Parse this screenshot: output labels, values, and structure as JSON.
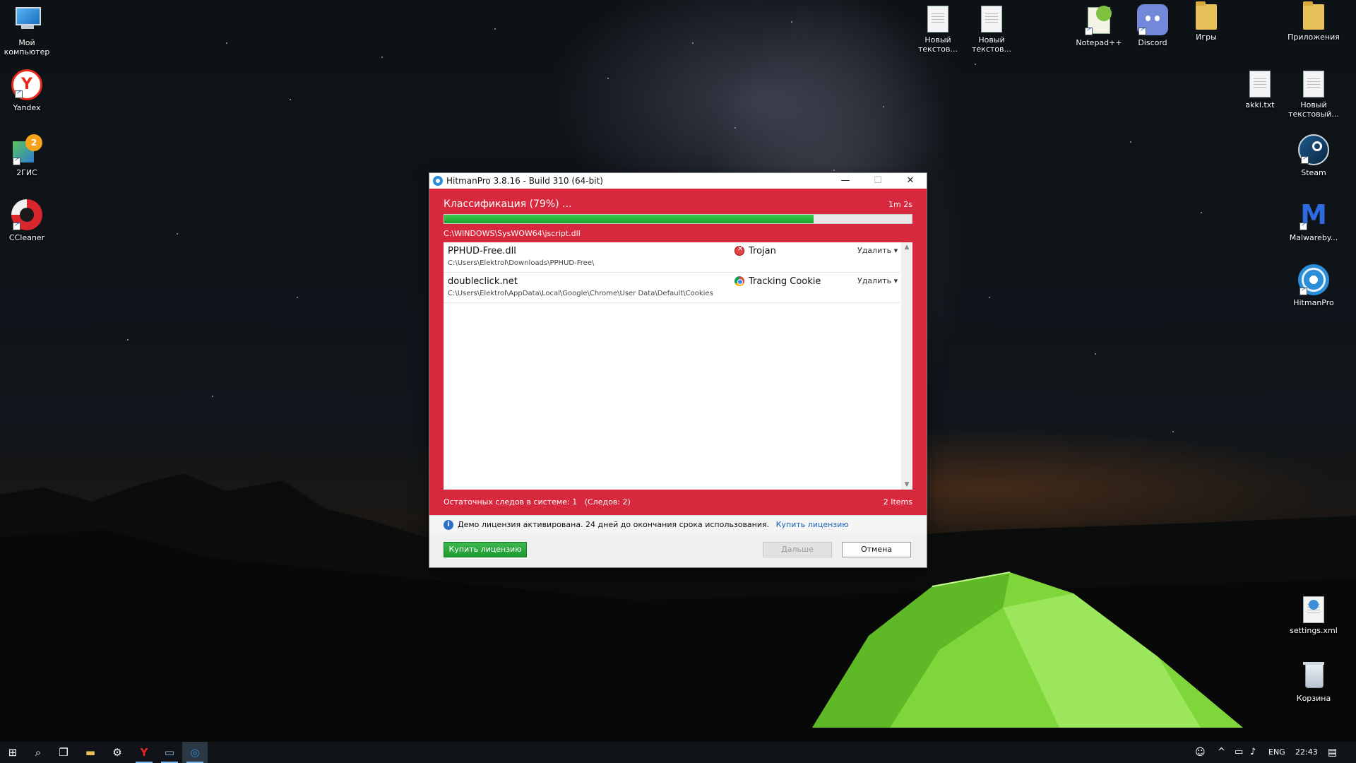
{
  "desktop": {
    "left_icons": [
      {
        "label": "Мой компьютер",
        "icon": "computer-icon"
      },
      {
        "label": "Yandex",
        "icon": "yandex-icon"
      },
      {
        "label": "2ГИС",
        "icon": "2gis-icon"
      },
      {
        "label": "CCleaner",
        "icon": "ccleaner-icon"
      }
    ],
    "top_icons": [
      {
        "label": "Новый текстов...",
        "icon": "text-document-icon"
      },
      {
        "label": "Новый текстов...",
        "icon": "text-document-icon"
      },
      {
        "label": "Notepad++",
        "icon": "notepadpp-icon"
      },
      {
        "label": "Discord",
        "icon": "discord-icon"
      },
      {
        "label": "Игры",
        "icon": "folder-icon"
      },
      {
        "label": "Приложения",
        "icon": "folder-icon"
      }
    ],
    "right_icons": [
      {
        "label": "akki.txt",
        "icon": "text-document-icon"
      },
      {
        "label": "Новый текстовый...",
        "icon": "text-document-icon"
      },
      {
        "label": "Steam",
        "icon": "steam-icon"
      },
      {
        "label": "Malwareby...",
        "icon": "malwarebytes-icon"
      },
      {
        "label": "HitmanPro",
        "icon": "hitmanpro-icon"
      },
      {
        "label": "settings.xml",
        "icon": "xml-document-icon"
      },
      {
        "label": "Корзина",
        "icon": "recycle-bin-icon"
      }
    ]
  },
  "window": {
    "title": "HitmanPro 3.8.16 - Build 310 (64-bit)",
    "controls": {
      "minimize": "—",
      "maximize": "☐",
      "close": "✕"
    },
    "status": "Классификация (79%) ...",
    "elapsed": "1m 2s",
    "progress_percent": 79,
    "current_file": "C:\\WINDOWS\\SysWOW64\\jscript.dll",
    "results": [
      {
        "name": "PPHUD-Free.dll",
        "path": "C:\\Users\\Elektrol\\Downloads\\PPHUD-Free\\",
        "type": "Trojan",
        "type_icon": "trojan-icon",
        "action": "Удалить ▾"
      },
      {
        "name": "doubleclick.net",
        "path": "C:\\Users\\Elektrol\\AppData\\Local\\Google\\Chrome\\User Data\\Default\\Cookies",
        "type": "Tracking Cookie",
        "type_icon": "chrome-icon",
        "action": "Удалить ▾"
      }
    ],
    "scroll_up": "▲",
    "scroll_down": "▼",
    "footer_left": "Остаточных следов в системе: 1   (Следов: 2)",
    "footer_right": "2 Items",
    "info_icon": "i",
    "info_text": "Демо лицензия активирована. 24 дней до окончания срока использования.",
    "info_link": "Купить лицензию",
    "buttons": {
      "buy": "Купить лицензию",
      "next": "Дальше",
      "cancel": "Отмена"
    },
    "colors": {
      "accent": "#d8283d",
      "progress": "#1aa530",
      "link": "#1a63b8"
    }
  },
  "taskbar": {
    "start": "⊞",
    "search": "⌕",
    "taskview": "❐",
    "explorer": "▬",
    "settings": "⚙",
    "yandex": "Y",
    "app": "▭",
    "hitmanpro": "◎",
    "tray_people": "☺",
    "tray_chevron": "^",
    "tray_network": "▭",
    "tray_volume": "♪",
    "language": "ENG",
    "time": "22:43",
    "notifications": "▤"
  }
}
